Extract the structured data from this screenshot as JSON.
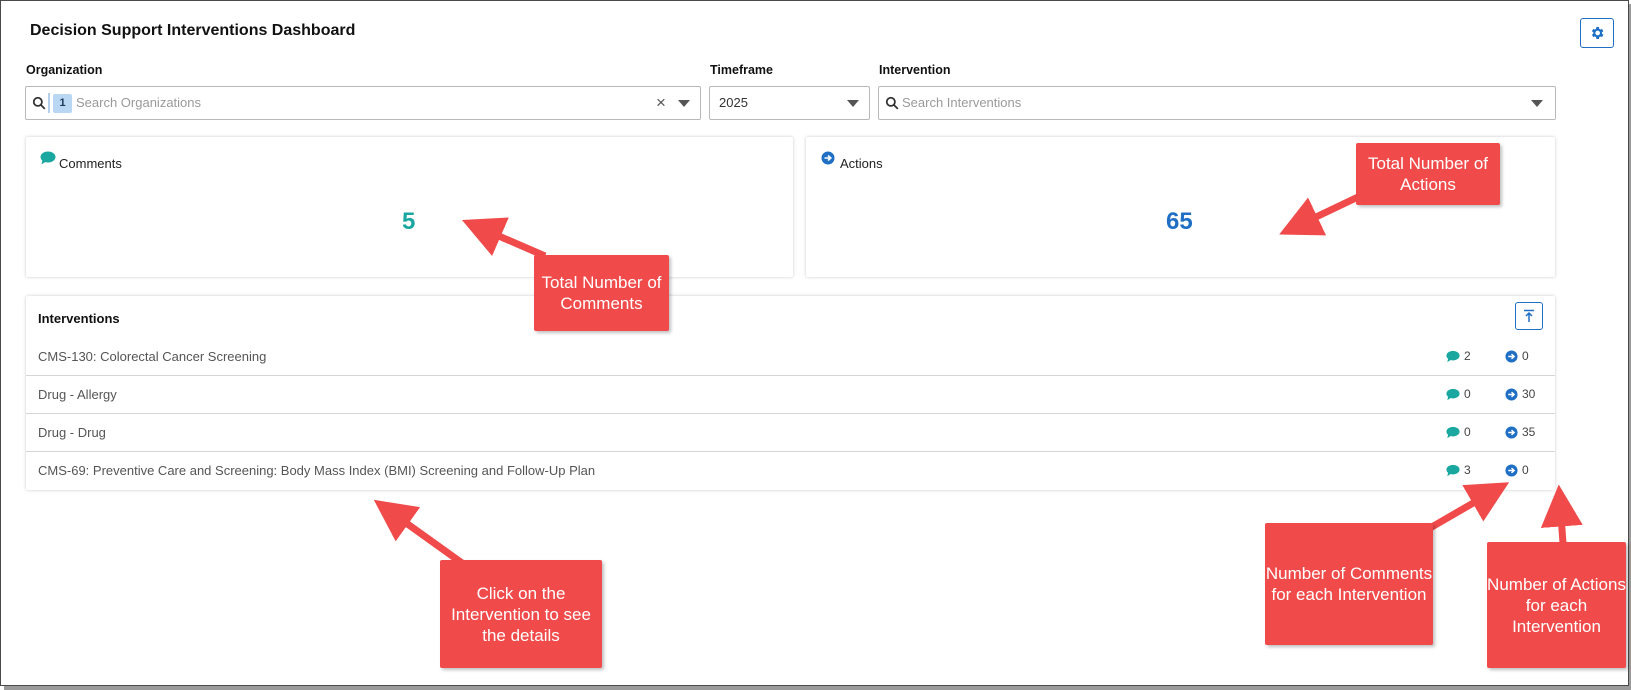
{
  "header": {
    "title": "Decision Support Interventions Dashboard"
  },
  "filters": {
    "organization": {
      "label": "Organization",
      "placeholder": "Search Organizations",
      "selected_count": "1"
    },
    "timeframe": {
      "label": "Timeframe",
      "value": "2025"
    },
    "intervention": {
      "label": "Intervention",
      "placeholder": "Search Interventions"
    }
  },
  "summary": {
    "comments": {
      "label": "Comments",
      "value": "5",
      "color": "#1aa7a0"
    },
    "actions": {
      "label": "Actions",
      "value": "65",
      "color": "#1f6fc5"
    }
  },
  "interventions": {
    "title": "Interventions",
    "rows": [
      {
        "name": "CMS-130: Colorectal Cancer Screening",
        "comments": "2",
        "actions": "0"
      },
      {
        "name": "Drug - Allergy",
        "comments": "0",
        "actions": "30"
      },
      {
        "name": "Drug - Drug",
        "comments": "0",
        "actions": "35"
      },
      {
        "name": "CMS-69: Preventive Care and Screening: Body Mass Index (BMI) Screening and Follow-Up Plan",
        "comments": "3",
        "actions": "0"
      }
    ]
  },
  "callouts": {
    "total_comments": "Total Number of Comments",
    "total_actions": "Total Number of Actions",
    "click_intervention": "Click on the Intervention to see the details",
    "comments_each": "Number of Comments for each Intervention",
    "actions_each": "Number of Actions for each Intervention"
  },
  "icons": {
    "settings": "gear-icon",
    "search": "search-icon",
    "clear": "close-icon",
    "dropdown": "caret-down-icon",
    "comment": "comment-bubble-icon",
    "action": "arrow-circle-right-icon",
    "export": "upload-icon"
  }
}
